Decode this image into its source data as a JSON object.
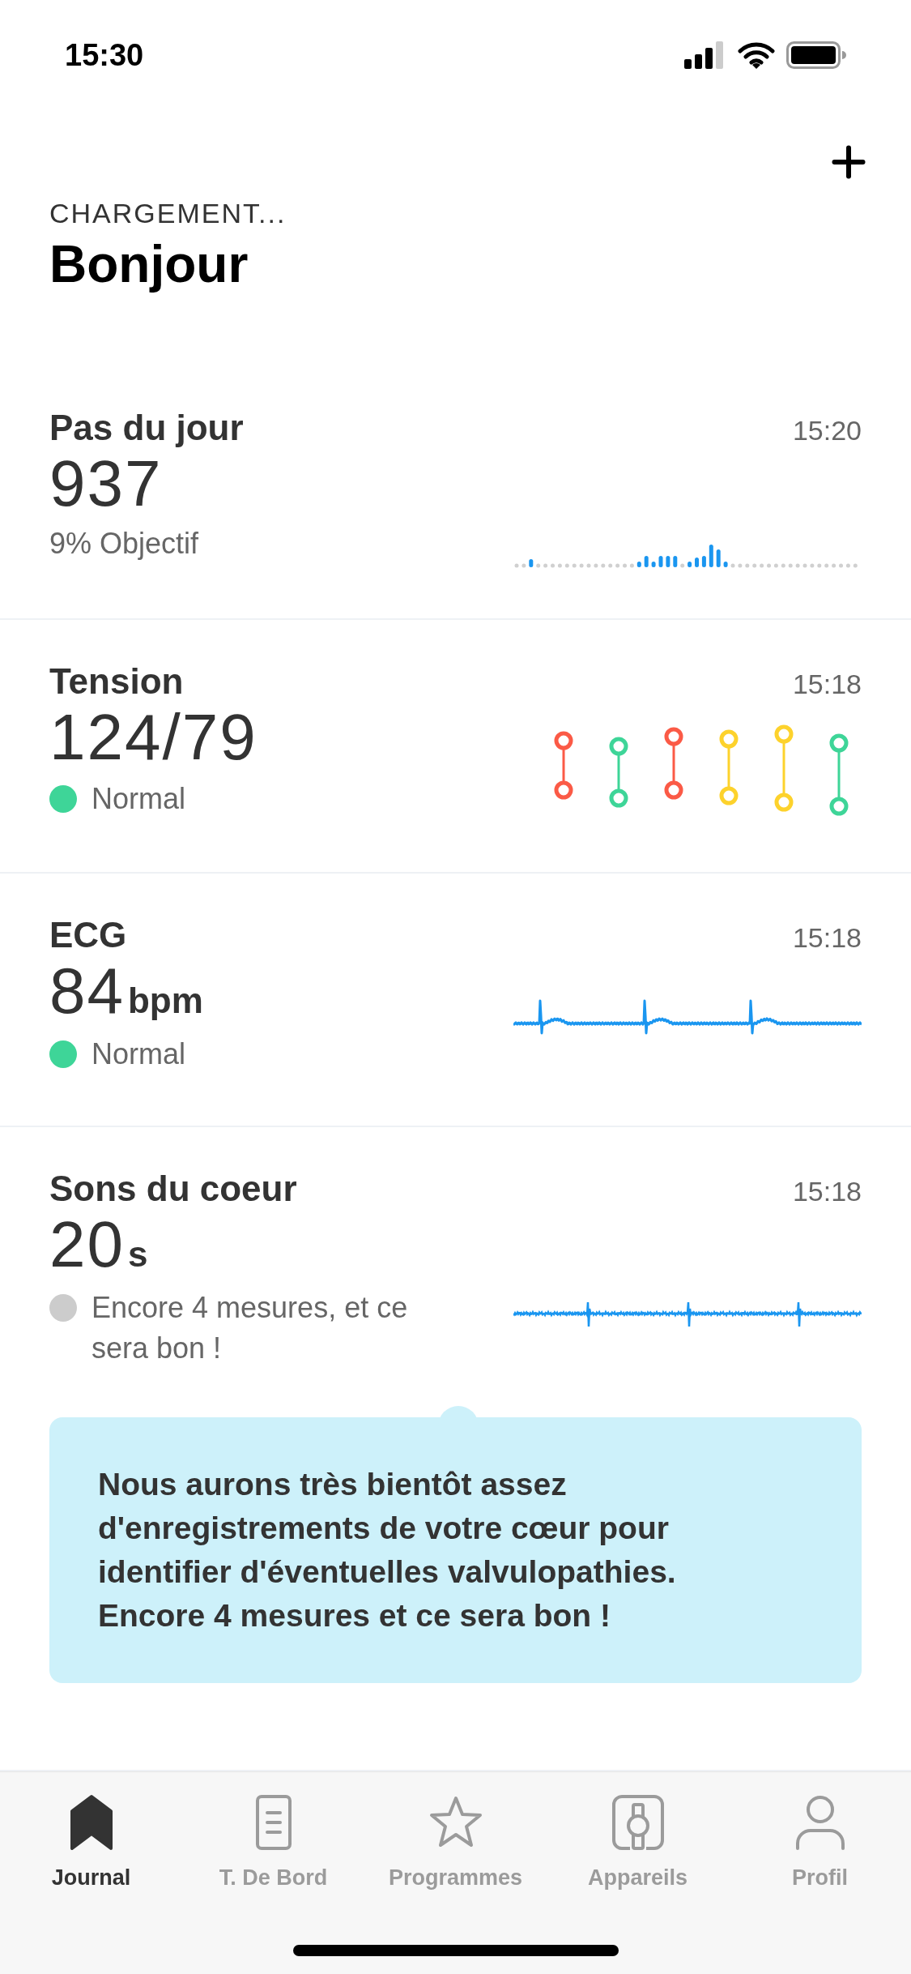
{
  "status_bar": {
    "time": "15:30"
  },
  "header": {
    "loading_label": "CHARGEMENT...",
    "greeting": "Bonjour"
  },
  "cards": [
    {
      "kind": "steps",
      "title": "Pas du jour",
      "value": "937",
      "time": "15:20",
      "subtitle": "9% Objectif"
    },
    {
      "kind": "tension",
      "title": "Tension",
      "value": "124/79",
      "time": "15:18",
      "status": {
        "label": "Normal",
        "color": "#3ed598"
      }
    },
    {
      "kind": "ecg",
      "title": "ECG",
      "value": "84",
      "unit": "bpm",
      "time": "15:18",
      "status": {
        "label": "Normal",
        "color": "#3ed598"
      }
    },
    {
      "kind": "heart_sounds",
      "title": "Sons du coeur",
      "value": "20",
      "unit": "s",
      "time": "15:18",
      "status": {
        "label": "Encore 4 mesures, et ce sera bon !",
        "color": "#cccccc"
      }
    }
  ],
  "tip": {
    "text": "Nous aurons très bientôt assez d'enregistrements de votre cœur pour identifier d'éventuelles valvulopathies. Encore 4 mesures et ce sera bon !"
  },
  "tabs": [
    {
      "kind": "journal",
      "label": "Journal",
      "selected": true
    },
    {
      "kind": "dashboard",
      "label": "T. De Bord",
      "selected": false
    },
    {
      "kind": "programs",
      "label": "Programmes",
      "selected": false
    },
    {
      "kind": "devices",
      "label": "Appareils",
      "selected": false
    },
    {
      "kind": "profile",
      "label": "Profil",
      "selected": false
    }
  ]
}
